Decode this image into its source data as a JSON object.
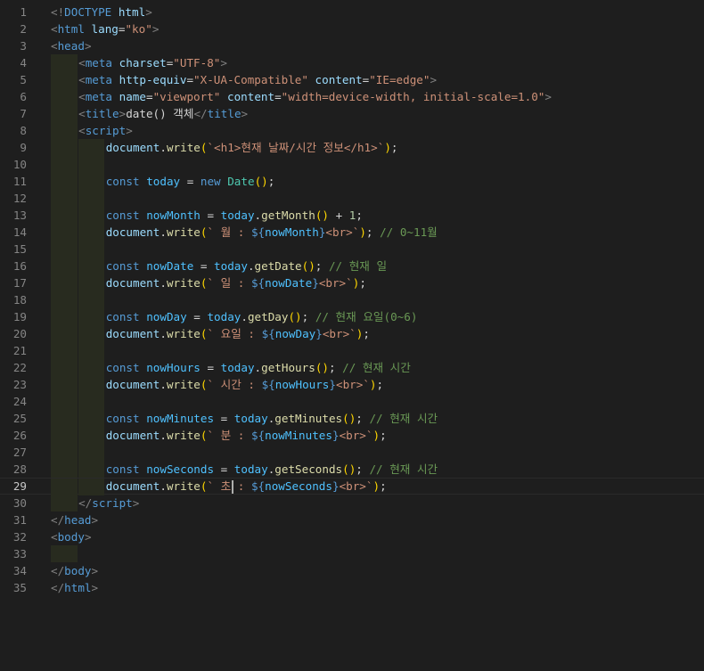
{
  "editor": {
    "language": "html",
    "active_line": 29,
    "lines": [
      {
        "n": "1",
        "indent": 0,
        "tokens": [
          [
            "tk-p",
            "<!"
          ],
          [
            "tk-tag",
            "DOCTYPE"
          ],
          [
            "tk-txt",
            " "
          ],
          [
            "tk-attr",
            "html"
          ],
          [
            "tk-p",
            ">"
          ]
        ]
      },
      {
        "n": "2",
        "indent": 0,
        "tokens": [
          [
            "tk-p",
            "<"
          ],
          [
            "tk-tag",
            "html"
          ],
          [
            "tk-txt",
            " "
          ],
          [
            "tk-attr",
            "lang"
          ],
          [
            "tk-txt",
            "="
          ],
          [
            "tk-str",
            "\"ko\""
          ],
          [
            "tk-p",
            ">"
          ]
        ]
      },
      {
        "n": "3",
        "indent": 0,
        "tokens": [
          [
            "tk-p",
            "<"
          ],
          [
            "tk-tag",
            "head"
          ],
          [
            "tk-p",
            ">"
          ]
        ]
      },
      {
        "n": "4",
        "indent": 1,
        "tokens": [
          [
            "tk-p",
            "<"
          ],
          [
            "tk-tag",
            "meta"
          ],
          [
            "tk-txt",
            " "
          ],
          [
            "tk-attr",
            "charset"
          ],
          [
            "tk-txt",
            "="
          ],
          [
            "tk-str",
            "\"UTF-8\""
          ],
          [
            "tk-p",
            ">"
          ]
        ]
      },
      {
        "n": "5",
        "indent": 1,
        "tokens": [
          [
            "tk-p",
            "<"
          ],
          [
            "tk-tag",
            "meta"
          ],
          [
            "tk-txt",
            " "
          ],
          [
            "tk-attr",
            "http-equiv"
          ],
          [
            "tk-txt",
            "="
          ],
          [
            "tk-str",
            "\"X-UA-Compatible\""
          ],
          [
            "tk-txt",
            " "
          ],
          [
            "tk-attr",
            "content"
          ],
          [
            "tk-txt",
            "="
          ],
          [
            "tk-str",
            "\"IE=edge\""
          ],
          [
            "tk-p",
            ">"
          ]
        ]
      },
      {
        "n": "6",
        "indent": 1,
        "tokens": [
          [
            "tk-p",
            "<"
          ],
          [
            "tk-tag",
            "meta"
          ],
          [
            "tk-txt",
            " "
          ],
          [
            "tk-attr",
            "name"
          ],
          [
            "tk-txt",
            "="
          ],
          [
            "tk-str",
            "\"viewport\""
          ],
          [
            "tk-txt",
            " "
          ],
          [
            "tk-attr",
            "content"
          ],
          [
            "tk-txt",
            "="
          ],
          [
            "tk-str",
            "\"width=device-width, initial-scale=1.0\""
          ],
          [
            "tk-p",
            ">"
          ]
        ]
      },
      {
        "n": "7",
        "indent": 1,
        "tokens": [
          [
            "tk-p",
            "<"
          ],
          [
            "tk-tag",
            "title"
          ],
          [
            "tk-p",
            ">"
          ],
          [
            "tk-txt",
            "date() 객체"
          ],
          [
            "tk-p",
            "</"
          ],
          [
            "tk-tag",
            "title"
          ],
          [
            "tk-p",
            ">"
          ]
        ]
      },
      {
        "n": "8",
        "indent": 1,
        "tokens": [
          [
            "tk-p",
            "<"
          ],
          [
            "tk-tag",
            "script"
          ],
          [
            "tk-p",
            ">"
          ]
        ]
      },
      {
        "n": "9",
        "indent": 2,
        "tokens": [
          [
            "tk-prop",
            "document"
          ],
          [
            "tk-txt",
            "."
          ],
          [
            "tk-fn",
            "write"
          ],
          [
            "tk-br1",
            "("
          ],
          [
            "tk-str",
            "`<h1>현재 날짜/시간 정보</h1>`"
          ],
          [
            "tk-br1",
            ")"
          ],
          [
            "tk-txt",
            ";"
          ]
        ]
      },
      {
        "n": "10",
        "indent": 2,
        "tokens": []
      },
      {
        "n": "11",
        "indent": 2,
        "tokens": [
          [
            "tk-kw",
            "const"
          ],
          [
            "tk-txt",
            " "
          ],
          [
            "tk-var",
            "today"
          ],
          [
            "tk-txt",
            " = "
          ],
          [
            "tk-kw",
            "new"
          ],
          [
            "tk-txt",
            " "
          ],
          [
            "tk-cls",
            "Date"
          ],
          [
            "tk-br1",
            "()"
          ],
          [
            "tk-txt",
            ";"
          ]
        ]
      },
      {
        "n": "12",
        "indent": 2,
        "tokens": []
      },
      {
        "n": "13",
        "indent": 2,
        "tokens": [
          [
            "tk-kw",
            "const"
          ],
          [
            "tk-txt",
            " "
          ],
          [
            "tk-var",
            "nowMonth"
          ],
          [
            "tk-txt",
            " = "
          ],
          [
            "tk-var",
            "today"
          ],
          [
            "tk-txt",
            "."
          ],
          [
            "tk-fn",
            "getMonth"
          ],
          [
            "tk-br1",
            "()"
          ],
          [
            "tk-txt",
            " + "
          ],
          [
            "tk-num",
            "1"
          ],
          [
            "tk-txt",
            ";"
          ]
        ]
      },
      {
        "n": "14",
        "indent": 2,
        "tokens": [
          [
            "tk-prop",
            "document"
          ],
          [
            "tk-txt",
            "."
          ],
          [
            "tk-fn",
            "write"
          ],
          [
            "tk-br1",
            "("
          ],
          [
            "tk-str",
            "` 월 : "
          ],
          [
            "tk-kw",
            "${"
          ],
          [
            "tk-var",
            "nowMonth"
          ],
          [
            "tk-kw",
            "}"
          ],
          [
            "tk-str",
            "<br>`"
          ],
          [
            "tk-br1",
            ")"
          ],
          [
            "tk-txt",
            "; "
          ],
          [
            "tk-cm",
            "// 0~11월"
          ]
        ]
      },
      {
        "n": "15",
        "indent": 2,
        "tokens": []
      },
      {
        "n": "16",
        "indent": 2,
        "tokens": [
          [
            "tk-kw",
            "const"
          ],
          [
            "tk-txt",
            " "
          ],
          [
            "tk-var",
            "nowDate"
          ],
          [
            "tk-txt",
            " = "
          ],
          [
            "tk-var",
            "today"
          ],
          [
            "tk-txt",
            "."
          ],
          [
            "tk-fn",
            "getDate"
          ],
          [
            "tk-br1",
            "()"
          ],
          [
            "tk-txt",
            "; "
          ],
          [
            "tk-cm",
            "// 현재 일"
          ]
        ]
      },
      {
        "n": "17",
        "indent": 2,
        "tokens": [
          [
            "tk-prop",
            "document"
          ],
          [
            "tk-txt",
            "."
          ],
          [
            "tk-fn",
            "write"
          ],
          [
            "tk-br1",
            "("
          ],
          [
            "tk-str",
            "` 일 : "
          ],
          [
            "tk-kw",
            "${"
          ],
          [
            "tk-var",
            "nowDate"
          ],
          [
            "tk-kw",
            "}"
          ],
          [
            "tk-str",
            "<br>`"
          ],
          [
            "tk-br1",
            ")"
          ],
          [
            "tk-txt",
            ";"
          ]
        ]
      },
      {
        "n": "18",
        "indent": 2,
        "tokens": []
      },
      {
        "n": "19",
        "indent": 2,
        "tokens": [
          [
            "tk-kw",
            "const"
          ],
          [
            "tk-txt",
            " "
          ],
          [
            "tk-var",
            "nowDay"
          ],
          [
            "tk-txt",
            " = "
          ],
          [
            "tk-var",
            "today"
          ],
          [
            "tk-txt",
            "."
          ],
          [
            "tk-fn",
            "getDay"
          ],
          [
            "tk-br1",
            "()"
          ],
          [
            "tk-txt",
            "; "
          ],
          [
            "tk-cm",
            "// 현재 요일(0~6)"
          ]
        ]
      },
      {
        "n": "20",
        "indent": 2,
        "tokens": [
          [
            "tk-prop",
            "document"
          ],
          [
            "tk-txt",
            "."
          ],
          [
            "tk-fn",
            "write"
          ],
          [
            "tk-br1",
            "("
          ],
          [
            "tk-str",
            "` 요일 : "
          ],
          [
            "tk-kw",
            "${"
          ],
          [
            "tk-var",
            "nowDay"
          ],
          [
            "tk-kw",
            "}"
          ],
          [
            "tk-str",
            "<br>`"
          ],
          [
            "tk-br1",
            ")"
          ],
          [
            "tk-txt",
            ";"
          ]
        ]
      },
      {
        "n": "21",
        "indent": 2,
        "tokens": []
      },
      {
        "n": "22",
        "indent": 2,
        "tokens": [
          [
            "tk-kw",
            "const"
          ],
          [
            "tk-txt",
            " "
          ],
          [
            "tk-var",
            "nowHours"
          ],
          [
            "tk-txt",
            " = "
          ],
          [
            "tk-var",
            "today"
          ],
          [
            "tk-txt",
            "."
          ],
          [
            "tk-fn",
            "getHours"
          ],
          [
            "tk-br1",
            "()"
          ],
          [
            "tk-txt",
            "; "
          ],
          [
            "tk-cm",
            "// 현재 시간"
          ]
        ]
      },
      {
        "n": "23",
        "indent": 2,
        "tokens": [
          [
            "tk-prop",
            "document"
          ],
          [
            "tk-txt",
            "."
          ],
          [
            "tk-fn",
            "write"
          ],
          [
            "tk-br1",
            "("
          ],
          [
            "tk-str",
            "` 시간 : "
          ],
          [
            "tk-kw",
            "${"
          ],
          [
            "tk-var",
            "nowHours"
          ],
          [
            "tk-kw",
            "}"
          ],
          [
            "tk-str",
            "<br>`"
          ],
          [
            "tk-br1",
            ")"
          ],
          [
            "tk-txt",
            ";"
          ]
        ]
      },
      {
        "n": "24",
        "indent": 2,
        "tokens": []
      },
      {
        "n": "25",
        "indent": 2,
        "tokens": [
          [
            "tk-kw",
            "const"
          ],
          [
            "tk-txt",
            " "
          ],
          [
            "tk-var",
            "nowMinutes"
          ],
          [
            "tk-txt",
            " = "
          ],
          [
            "tk-var",
            "today"
          ],
          [
            "tk-txt",
            "."
          ],
          [
            "tk-fn",
            "getMinutes"
          ],
          [
            "tk-br1",
            "()"
          ],
          [
            "tk-txt",
            "; "
          ],
          [
            "tk-cm",
            "// 현재 시간"
          ]
        ]
      },
      {
        "n": "26",
        "indent": 2,
        "tokens": [
          [
            "tk-prop",
            "document"
          ],
          [
            "tk-txt",
            "."
          ],
          [
            "tk-fn",
            "write"
          ],
          [
            "tk-br1",
            "("
          ],
          [
            "tk-str",
            "` 분 : "
          ],
          [
            "tk-kw",
            "${"
          ],
          [
            "tk-var",
            "nowMinutes"
          ],
          [
            "tk-kw",
            "}"
          ],
          [
            "tk-str",
            "<br>`"
          ],
          [
            "tk-br1",
            ")"
          ],
          [
            "tk-txt",
            ";"
          ]
        ]
      },
      {
        "n": "27",
        "indent": 2,
        "tokens": []
      },
      {
        "n": "28",
        "indent": 2,
        "tokens": [
          [
            "tk-kw",
            "const"
          ],
          [
            "tk-txt",
            " "
          ],
          [
            "tk-var",
            "nowSeconds"
          ],
          [
            "tk-txt",
            " = "
          ],
          [
            "tk-var",
            "today"
          ],
          [
            "tk-txt",
            "."
          ],
          [
            "tk-fn",
            "getSeconds"
          ],
          [
            "tk-br1",
            "()"
          ],
          [
            "tk-txt",
            "; "
          ],
          [
            "tk-cm",
            "// 현재 시간"
          ]
        ]
      },
      {
        "n": "29",
        "indent": 2,
        "cursor": true,
        "tokens": [
          [
            "tk-prop",
            "document"
          ],
          [
            "tk-txt",
            "."
          ],
          [
            "tk-fn",
            "write"
          ],
          [
            "tk-br1",
            "("
          ],
          [
            "tk-str",
            "` 초 : "
          ],
          [
            "tk-kw",
            "${"
          ],
          [
            "tk-var",
            "nowSeconds"
          ],
          [
            "tk-kw",
            "}"
          ],
          [
            "tk-str",
            "<br>`"
          ],
          [
            "tk-br1",
            ")"
          ],
          [
            "tk-txt",
            ";"
          ]
        ]
      },
      {
        "n": "30",
        "indent": 1,
        "tokens": [
          [
            "tk-p",
            "</"
          ],
          [
            "tk-tag",
            "script"
          ],
          [
            "tk-p",
            ">"
          ]
        ]
      },
      {
        "n": "31",
        "indent": 0,
        "tokens": [
          [
            "tk-p",
            "</"
          ],
          [
            "tk-tag",
            "head"
          ],
          [
            "tk-p",
            ">"
          ]
        ]
      },
      {
        "n": "32",
        "indent": 0,
        "tokens": [
          [
            "tk-p",
            "<"
          ],
          [
            "tk-tag",
            "body"
          ],
          [
            "tk-p",
            ">"
          ]
        ]
      },
      {
        "n": "33",
        "indent": 1,
        "tokens": []
      },
      {
        "n": "34",
        "indent": 0,
        "tokens": [
          [
            "tk-p",
            "</"
          ],
          [
            "tk-tag",
            "body"
          ],
          [
            "tk-p",
            ">"
          ]
        ]
      },
      {
        "n": "35",
        "indent": 0,
        "tokens": [
          [
            "tk-p",
            "</"
          ],
          [
            "tk-tag",
            "html"
          ],
          [
            "tk-p",
            ">"
          ]
        ]
      }
    ]
  }
}
